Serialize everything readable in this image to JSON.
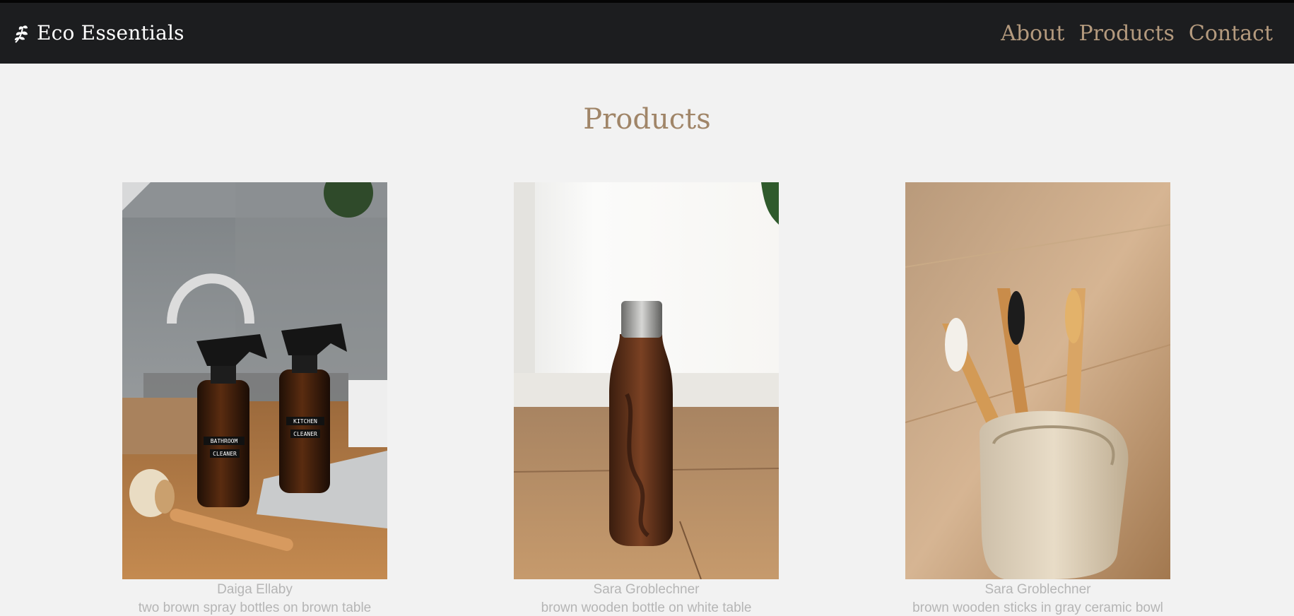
{
  "header": {
    "brand_name": "Eco Essentials",
    "brand_icon": "leaf-sprig-icon",
    "nav": [
      {
        "label": "About"
      },
      {
        "label": "Products"
      },
      {
        "label": "Contact"
      }
    ]
  },
  "main": {
    "title": "Products",
    "products": [
      {
        "image": "spray-bottles-photo",
        "bottle_labels": [
          "BATHROOM",
          "CLEANER",
          "KITCHEN",
          "CLEANER"
        ],
        "credit": "Daiga Ellaby",
        "caption": "two brown spray bottles on brown table"
      },
      {
        "image": "wooden-bottle-photo",
        "credit": "Sara Groblechner",
        "caption": "brown wooden bottle on white table"
      },
      {
        "image": "bamboo-toothbrushes-photo",
        "credit": "Sara Groblechner",
        "caption": "brown wooden sticks in gray ceramic bowl"
      }
    ]
  },
  "colors": {
    "header_bg": "#1c1d1f",
    "nav_link": "#b49a7e",
    "title": "#a08568",
    "page_bg": "#f2f2f2",
    "caption_text": "#b5b5b5"
  }
}
